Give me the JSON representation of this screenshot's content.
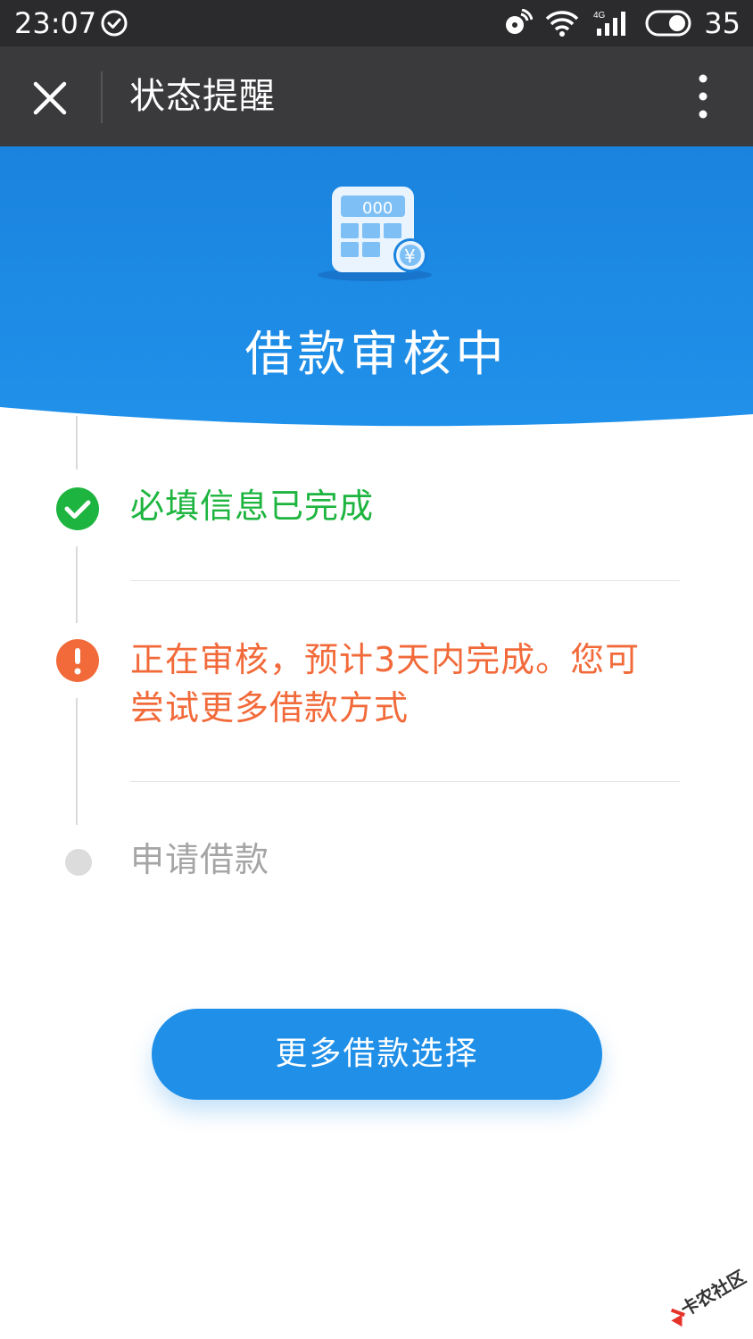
{
  "status_bar": {
    "time": "23:07",
    "battery": "35"
  },
  "nav": {
    "title": "状态提醒"
  },
  "header": {
    "title": "借款审核中",
    "icon_text": "000",
    "icon_symbol": "¥"
  },
  "steps": [
    {
      "status": "done",
      "text": "必填信息已完成",
      "color": "#1db53f"
    },
    {
      "status": "warning",
      "text": "正在审核，预计3天内完成。您可尝试更多借款方式",
      "color": "#f26a3a"
    },
    {
      "status": "pending",
      "text": "申请借款",
      "color": "#a5a5a5"
    }
  ],
  "cta": {
    "label": "更多借款选择"
  },
  "watermark": {
    "text": "卡农社区"
  },
  "colors": {
    "primary": "#1f8fe8",
    "nav_bg": "#3a3a3d",
    "status_bg": "#2b2b2d"
  }
}
